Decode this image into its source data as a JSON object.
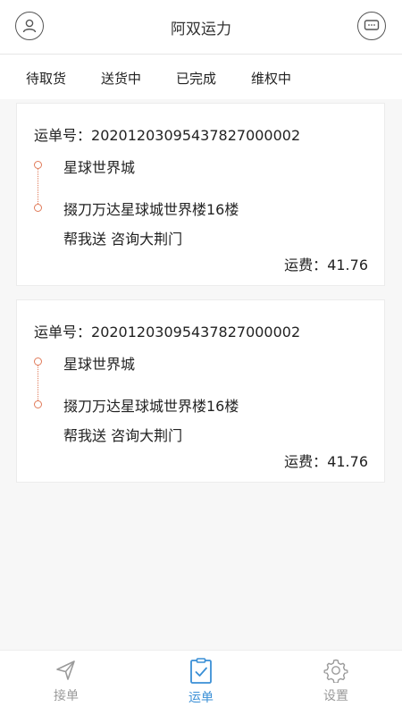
{
  "header": {
    "title": "阿双运力",
    "left_icon": "user-avatar-icon",
    "right_icon": "message-bubble-icon"
  },
  "tabs": [
    {
      "label": "待取货"
    },
    {
      "label": "送货中"
    },
    {
      "label": "已完成"
    },
    {
      "label": "维权中"
    }
  ],
  "orders": [
    {
      "order_label": "运单号：",
      "order_no": "20201203095437827000002",
      "from": "星球世界城",
      "to": "掇刀万达星球城世界楼16楼",
      "service": "帮我送 咨询大荆门",
      "fee_label": "运费：",
      "fee": "41.76"
    },
    {
      "order_label": "运单号：",
      "order_no": "20201203095437827000002",
      "from": "星球世界城",
      "to": "掇刀万达星球城世界楼16楼",
      "service": "帮我送 咨询大荆门",
      "fee_label": "运费：",
      "fee": "41.76"
    }
  ],
  "bottom_nav": [
    {
      "label": "接单",
      "icon": "send-arrow-icon",
      "active": false
    },
    {
      "label": "运单",
      "icon": "clipboard-check-icon",
      "active": true
    },
    {
      "label": "设置",
      "icon": "gear-icon",
      "active": false
    }
  ],
  "colors": {
    "accent": "#3a8fd6",
    "route": "#e07b5a",
    "inactive": "#9a9a9a"
  }
}
